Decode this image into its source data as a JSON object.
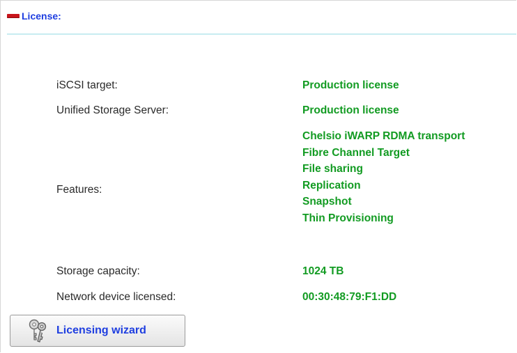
{
  "header": {
    "title": "License:",
    "icon": "collapse-icon"
  },
  "rows": {
    "iscsi": {
      "label": "iSCSI target:",
      "value": "Production license"
    },
    "uss": {
      "label": "Unified Storage Server:",
      "value": "Production license"
    },
    "features": {
      "label": "Features:",
      "values": [
        "Chelsio iWARP RDMA transport",
        "Fibre Channel Target",
        "File sharing",
        "Replication",
        "Snapshot",
        "Thin Provisioning"
      ]
    },
    "capacity": {
      "label": "Storage capacity:",
      "value": "1024 TB"
    },
    "network": {
      "label": "Network device licensed:",
      "value": "00:30:48:79:F1:DD"
    }
  },
  "wizard_button": {
    "label": "Licensing wizard",
    "icon": "keys-icon"
  },
  "colors": {
    "accent": "#1e3ee0",
    "value": "#129b22",
    "rule": "#c7ecf1",
    "collapse": "#c8141b"
  }
}
